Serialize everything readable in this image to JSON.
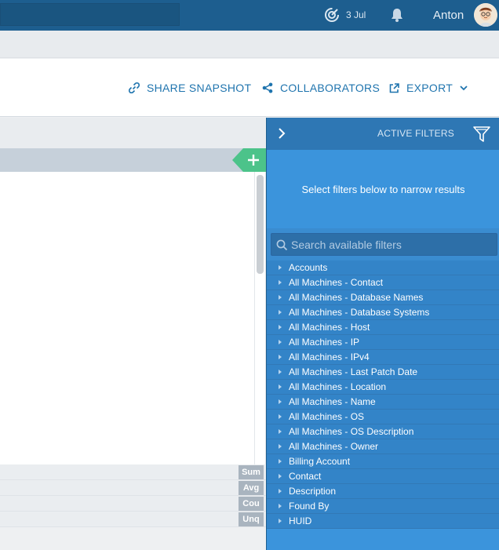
{
  "topbar": {
    "date": "3 Jul",
    "username": "Anton",
    "icons": [
      "progress-icon",
      "bell-icon",
      "avatar"
    ]
  },
  "toolbar": {
    "share_snapshot": "SHARE SNAPSHOT",
    "collaborators": "COLLABORATORS",
    "export": "EXPORT"
  },
  "left_panel": {
    "footer_labels": [
      "Sum",
      "Avg",
      "Cou",
      "Unq"
    ]
  },
  "filters_panel": {
    "title": "ACTIVE FILTERS",
    "hint": "Select filters below to narrow results",
    "search_placeholder": "Search available filters",
    "items": [
      "Accounts",
      "All Machines - Contact",
      "All Machines - Database Names",
      "All Machines - Database Systems",
      "All Machines - Host",
      "All Machines - IP",
      "All Machines - IPv4",
      "All Machines - Last Patch Date",
      "All Machines - Location",
      "All Machines - Name",
      "All Machines - OS",
      "All Machines - OS Description",
      "All Machines - Owner",
      "Billing Account",
      "Contact",
      "Description",
      "Found By",
      "HUID"
    ]
  },
  "colors": {
    "topbar": "#1d5e8f",
    "accent": "#1f74ae",
    "panel_blue": "#3a8cd0",
    "add_green": "#4cc38a"
  }
}
